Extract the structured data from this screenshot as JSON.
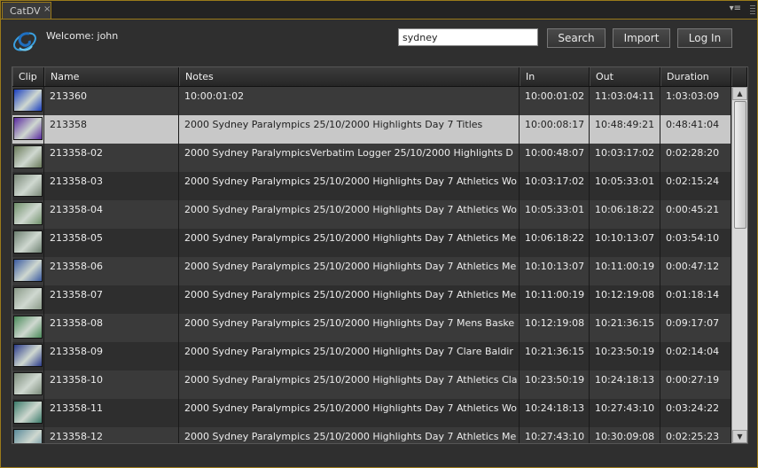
{
  "tab": {
    "label": "CatDV",
    "close": "×",
    "menu": "▾≡"
  },
  "header": {
    "welcome": "Welcome:  john",
    "search_value": "sydney",
    "search_button": "Search",
    "import_button": "Import",
    "login_button": "Log In"
  },
  "table": {
    "columns": {
      "clip": "Clip",
      "name": "Name",
      "notes": "Notes",
      "in": "In",
      "out": "Out",
      "duration": "Duration"
    },
    "selected_index": 1,
    "rows": [
      {
        "name": "213360",
        "notes": "10:00:01:02",
        "in": "10:00:01:02",
        "out": "11:03:04:11",
        "duration": "1:03:03:09",
        "thumb": "#1a3fbf"
      },
      {
        "name": "213358",
        "notes": "2000 Sydney Paralympics 25/10/2000 Highlights Day 7 Titles",
        "in": "10:00:08:17",
        "out": "10:48:49:21",
        "duration": "0:48:41:04",
        "thumb": "#5a2aa0"
      },
      {
        "name": "213358-02",
        "notes": "2000 Sydney ParalympicsVerbatim Logger 25/10/2000 Highlights D",
        "in": "10:00:48:07",
        "out": "10:03:17:02",
        "duration": "0:02:28:20",
        "thumb": "#6a7a5a"
      },
      {
        "name": "213358-03",
        "notes": "2000 Sydney Paralympics 25/10/2000 Highlights Day 7 Athletics Wo",
        "in": "10:03:17:02",
        "out": "10:05:33:01",
        "duration": "0:02:15:24",
        "thumb": "#7a8878"
      },
      {
        "name": "213358-04",
        "notes": "2000 Sydney Paralympics 25/10/2000 Highlights Day 7 Athletics Wo",
        "in": "10:05:33:01",
        "out": "10:06:18:22",
        "duration": "0:00:45:21",
        "thumb": "#6f8f6a"
      },
      {
        "name": "213358-05",
        "notes": "2000 Sydney Paralympics 25/10/2000 Highlights Day 7 Athletics Me",
        "in": "10:06:18:22",
        "out": "10:10:13:07",
        "duration": "0:03:54:10",
        "thumb": "#6c7f70"
      },
      {
        "name": "213358-06",
        "notes": "2000 Sydney Paralympics 25/10/2000 Highlights Day 7 Athletics Me",
        "in": "10:10:13:07",
        "out": "10:11:00:19",
        "duration": "0:00:47:12",
        "thumb": "#3a5aa0"
      },
      {
        "name": "213358-07",
        "notes": "2000 Sydney Paralympics 25/10/2000 Highlights Day 7 Athletics Me",
        "in": "10:11:00:19",
        "out": "10:12:19:08",
        "duration": "0:01:18:14",
        "thumb": "#8a9a88"
      },
      {
        "name": "213358-08",
        "notes": "2000 Sydney Paralympics 25/10/2000 Highlights Day 7 Mens Baske",
        "in": "10:12:19:08",
        "out": "10:21:36:15",
        "duration": "0:09:17:07",
        "thumb": "#4a8a5a"
      },
      {
        "name": "213358-09",
        "notes": "2000 Sydney Paralympics 25/10/2000 Highlights Day 7 Clare Baldir",
        "in": "10:21:36:15",
        "out": "10:23:50:19",
        "duration": "0:02:14:04",
        "thumb": "#2a3a8a"
      },
      {
        "name": "213358-10",
        "notes": "2000 Sydney Paralympics 25/10/2000 Highlights Day 7 Athletics Cla",
        "in": "10:23:50:19",
        "out": "10:24:18:13",
        "duration": "0:00:27:19",
        "thumb": "#7a8a7a"
      },
      {
        "name": "213358-11",
        "notes": "2000 Sydney Paralympics 25/10/2000 Highlights Day 7 Athletics Wo",
        "in": "10:24:18:13",
        "out": "10:27:43:10",
        "duration": "0:03:24:22",
        "thumb": "#3a7a6a"
      },
      {
        "name": "213358-12",
        "notes": "2000 Sydney Paralympics 25/10/2000 Highlights Day 7 Athletics Me",
        "in": "10:27:43:10",
        "out": "10:30:09:08",
        "duration": "0:02:25:23",
        "thumb": "#5a8a9a"
      }
    ]
  },
  "scrollbar": {
    "up": "▲",
    "down": "▼"
  }
}
